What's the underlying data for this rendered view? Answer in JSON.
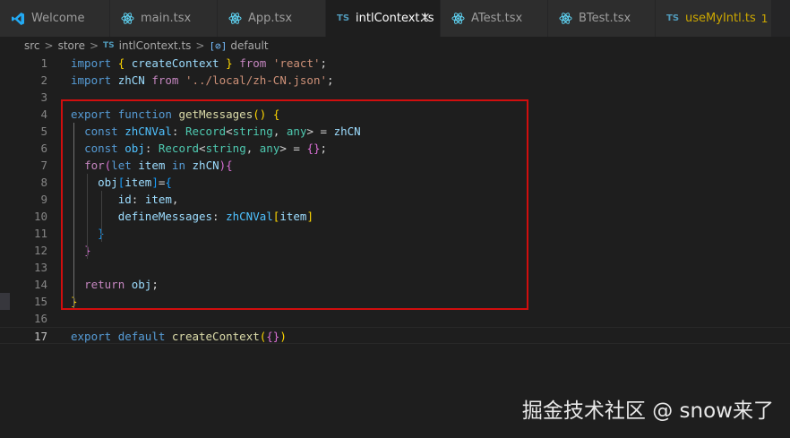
{
  "tabs": [
    {
      "label": "Welcome",
      "icon": "vscode-logo-icon",
      "active": false
    },
    {
      "label": "main.tsx",
      "icon": "react-icon",
      "active": false
    },
    {
      "label": "App.tsx",
      "icon": "react-icon",
      "active": false
    },
    {
      "label": "intlContext.ts",
      "icon": "typescript-icon",
      "icon_text": "TS",
      "active": true,
      "close": "×"
    },
    {
      "label": "ATest.tsx",
      "icon": "react-icon",
      "active": false
    },
    {
      "label": "BTest.tsx",
      "icon": "react-icon",
      "active": false
    },
    {
      "label": "useMyIntl.ts",
      "icon": "typescript-icon",
      "icon_text": "TS",
      "active": false,
      "badge": "1",
      "modified": true
    }
  ],
  "breadcrumb": {
    "items": [
      "src",
      "store",
      "intlContext.ts",
      "default"
    ],
    "separator": ">",
    "file_icon_text": "TS",
    "symbol_icon": "symbol-variable-icon",
    "symbol_icon_text": "[⊘]"
  },
  "editor": {
    "current_line": 17,
    "lines": [
      {
        "n": "1",
        "tokens": [
          [
            "import",
            "kw"
          ],
          [
            " ",
            "pun"
          ],
          [
            "{",
            "b1"
          ],
          [
            " ",
            "pun"
          ],
          [
            "createContext",
            "var"
          ],
          [
            " ",
            "pun"
          ],
          [
            "}",
            "b1"
          ],
          [
            " ",
            "pun"
          ],
          [
            "from",
            "ctl"
          ],
          [
            " ",
            "pun"
          ],
          [
            "'react'",
            "str"
          ],
          [
            ";",
            "pun"
          ]
        ]
      },
      {
        "n": "2",
        "tokens": [
          [
            "import",
            "kw"
          ],
          [
            " ",
            "pun"
          ],
          [
            "zhCN",
            "var"
          ],
          [
            " ",
            "pun"
          ],
          [
            "from",
            "ctl"
          ],
          [
            " ",
            "pun"
          ],
          [
            "'../local/zh-CN.json'",
            "str"
          ],
          [
            ";",
            "pun"
          ]
        ]
      },
      {
        "n": "3",
        "tokens": []
      },
      {
        "n": "4",
        "tokens": [
          [
            "export",
            "kw"
          ],
          [
            " ",
            "pun"
          ],
          [
            "function",
            "kw"
          ],
          [
            " ",
            "pun"
          ],
          [
            "getMessages",
            "fn"
          ],
          [
            "()",
            "b1"
          ],
          [
            " ",
            "pun"
          ],
          [
            "{",
            "b1"
          ]
        ]
      },
      {
        "n": "5",
        "tokens": [
          [
            "  ",
            "pun"
          ],
          [
            "const",
            "kw"
          ],
          [
            " ",
            "pun"
          ],
          [
            "zhCNVal",
            "con"
          ],
          [
            ": ",
            "pun"
          ],
          [
            "Record",
            "typ"
          ],
          [
            "<",
            "pun"
          ],
          [
            "string",
            "typ"
          ],
          [
            ", ",
            "pun"
          ],
          [
            "any",
            "typ"
          ],
          [
            "> = ",
            "pun"
          ],
          [
            "zhCN",
            "var"
          ]
        ]
      },
      {
        "n": "6",
        "tokens": [
          [
            "  ",
            "pun"
          ],
          [
            "const",
            "kw"
          ],
          [
            " ",
            "pun"
          ],
          [
            "obj",
            "con"
          ],
          [
            ": ",
            "pun"
          ],
          [
            "Record",
            "typ"
          ],
          [
            "<",
            "pun"
          ],
          [
            "string",
            "typ"
          ],
          [
            ", ",
            "pun"
          ],
          [
            "any",
            "typ"
          ],
          [
            "> = ",
            "pun"
          ],
          [
            "{}",
            "b2"
          ],
          [
            ";",
            "pun"
          ]
        ]
      },
      {
        "n": "7",
        "tokens": [
          [
            "  ",
            "pun"
          ],
          [
            "for",
            "ctl"
          ],
          [
            "(",
            "b2"
          ],
          [
            "let",
            "kw"
          ],
          [
            " ",
            "pun"
          ],
          [
            "item",
            "var"
          ],
          [
            " ",
            "pun"
          ],
          [
            "in",
            "kw"
          ],
          [
            " ",
            "pun"
          ],
          [
            "zhCN",
            "var"
          ],
          [
            ")",
            "b2"
          ],
          [
            "{",
            "b2"
          ]
        ]
      },
      {
        "n": "8",
        "tokens": [
          [
            "    ",
            "pun"
          ],
          [
            "obj",
            "var"
          ],
          [
            "[",
            "b3"
          ],
          [
            "item",
            "var"
          ],
          [
            "]",
            "b3"
          ],
          [
            "=",
            "pun"
          ],
          [
            "{",
            "b3"
          ]
        ]
      },
      {
        "n": "9",
        "tokens": [
          [
            "       ",
            "pun"
          ],
          [
            "id",
            "var"
          ],
          [
            ": ",
            "pun"
          ],
          [
            "item",
            "var"
          ],
          [
            ",",
            "pun"
          ]
        ]
      },
      {
        "n": "10",
        "tokens": [
          [
            "       ",
            "pun"
          ],
          [
            "defineMessages",
            "var"
          ],
          [
            ": ",
            "pun"
          ],
          [
            "zhCNVal",
            "con"
          ],
          [
            "[",
            "b1"
          ],
          [
            "item",
            "var"
          ],
          [
            "]",
            "b1"
          ]
        ]
      },
      {
        "n": "11",
        "tokens": [
          [
            "    ",
            "pun"
          ],
          [
            "}",
            "b3"
          ]
        ]
      },
      {
        "n": "12",
        "tokens": [
          [
            "  ",
            "pun"
          ],
          [
            "}",
            "b2"
          ]
        ]
      },
      {
        "n": "13",
        "tokens": []
      },
      {
        "n": "14",
        "tokens": [
          [
            "  ",
            "pun"
          ],
          [
            "return",
            "ctl"
          ],
          [
            " ",
            "pun"
          ],
          [
            "obj",
            "var"
          ],
          [
            ";",
            "pun"
          ]
        ]
      },
      {
        "n": "15",
        "tokens": [
          [
            "}",
            "b1"
          ]
        ]
      },
      {
        "n": "16",
        "tokens": []
      },
      {
        "n": "17",
        "tokens": [
          [
            "export",
            "kw"
          ],
          [
            " ",
            "pun"
          ],
          [
            "default",
            "kw"
          ],
          [
            " ",
            "pun"
          ],
          [
            "createContext",
            "fn"
          ],
          [
            "(",
            "b1"
          ],
          [
            "{}",
            "b2"
          ],
          [
            ")",
            "b1"
          ]
        ]
      }
    ]
  },
  "watermark": "掘金技术社区 @ snow来了",
  "colors": {
    "highlight_box": "#d10e0e",
    "editor_bg": "#1e1e1e",
    "tab_bg": "#2d2d2d",
    "typescript_blue": "#519aba",
    "react_blue": "#61dafb",
    "vscode_blue": "#23a9f2",
    "modified_yellow": "#cca700"
  }
}
